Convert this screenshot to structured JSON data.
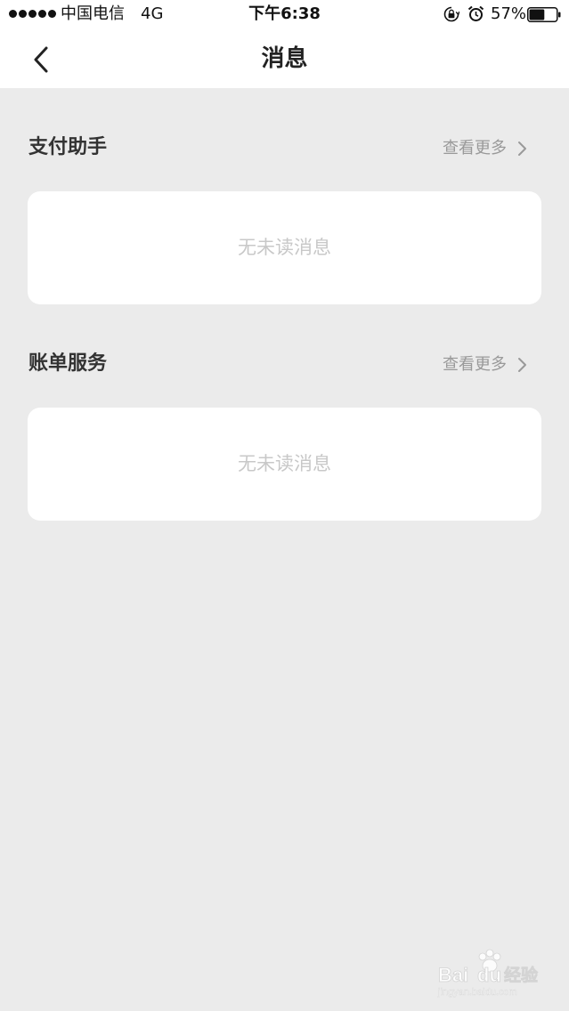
{
  "status_bar": {
    "carrier": "中国电信",
    "network": "4G",
    "time": "下午6:38",
    "battery_percent": "57%",
    "battery_level": 0.57,
    "icons": [
      "signal-dots",
      "orientation-lock-icon",
      "alarm-icon",
      "battery-icon"
    ]
  },
  "nav": {
    "back_icon": "chevron-left-icon",
    "title": "消息"
  },
  "sections": [
    {
      "title": "支付助手",
      "see_more": "查看更多",
      "empty_text": "无未读消息"
    },
    {
      "title": "账单服务",
      "see_more": "查看更多",
      "empty_text": "无未读消息"
    }
  ],
  "watermark": {
    "brand": "Baidu经验"
  },
  "colors": {
    "page_background": "#ebebeb",
    "card_background": "#ffffff",
    "muted_text": "#999999",
    "empty_text": "#c8c8c8"
  }
}
